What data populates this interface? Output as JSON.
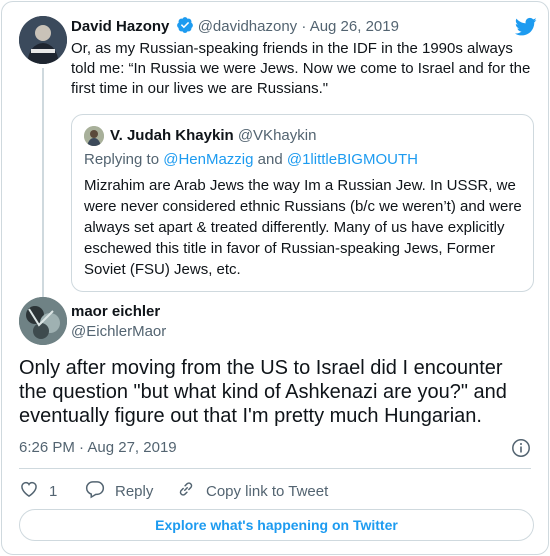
{
  "parent": {
    "name": "David Hazony",
    "handle": "@davidhazony",
    "date": "Aug 26, 2019",
    "separator": "·",
    "text": "Or, as my Russian-speaking friends in the IDF in the 1990s always told me: “In Russia we were Jews. Now we come to Israel and for the first time in our lives we are Russians.\"",
    "verified": true
  },
  "quote": {
    "name": "V. Judah Khaykin",
    "handle": "@VKhaykin",
    "replying_prefix": "Replying to",
    "replying_to_1": "@HenMazzig",
    "replying_and": "and",
    "replying_to_2": "@1littleBIGMOUTH",
    "text": "Mizrahim are Arab Jews the way Im a Russian Jew. In USSR, we were never considered ethnic Russians (b/c we weren’t) and were always set apart & treated differently. Many of us have explicitly eschewed this title in favor of Russian-speaking Jews, Former Soviet (FSU) Jews, etc."
  },
  "tweet": {
    "name": "maor eichler",
    "handle": "@EichlerMaor",
    "text": "Only after moving from the US to Israel did I encounter the question \"but what kind of Ashkenazi are you?\" and eventually figure out that I'm pretty much Hungarian.",
    "time": "6:26 PM",
    "date": "Aug 27, 2019",
    "separator": "·"
  },
  "actions": {
    "like_count": "1",
    "reply_label": "Reply",
    "copy_link_label": "Copy link to Tweet"
  },
  "footer": {
    "explore_label": "Explore what's happening on Twitter"
  },
  "colors": {
    "accent": "#1d9bf0",
    "muted": "#536471",
    "border": "#cfd9de"
  },
  "icons": [
    "twitter-bird-icon",
    "verified-badge-icon",
    "info-icon",
    "heart-icon",
    "reply-icon",
    "link-icon"
  ]
}
